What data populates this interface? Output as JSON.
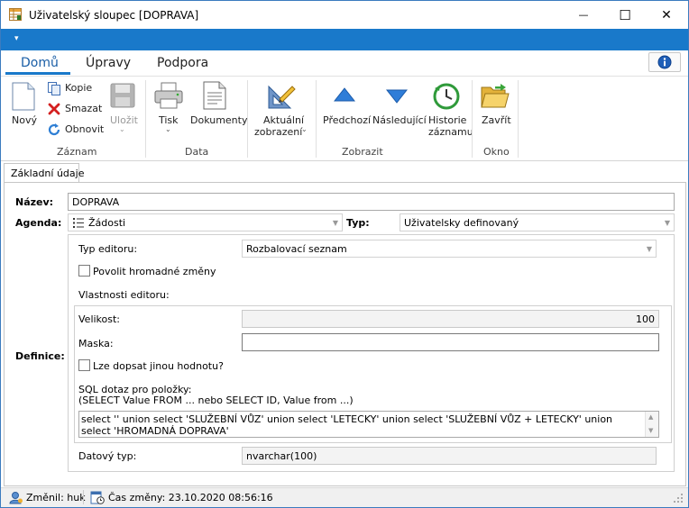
{
  "window": {
    "title": "Uživatelský sloupec [DOPRAVA]",
    "minimize_glyph": "—",
    "maximize_glyph": "☐",
    "close_glyph": "✕"
  },
  "qat": {
    "arrow_glyph": "▾"
  },
  "tabs": [
    {
      "label": "Domů"
    },
    {
      "label": "Úpravy"
    },
    {
      "label": "Podpora"
    }
  ],
  "info_icon": "info-icon",
  "ribbon": {
    "zaznam": {
      "label": "Záznam",
      "novy": "Nový",
      "kopie": "Kopie",
      "smazat": "Smazat",
      "obnovit": "Obnovit",
      "ulozit": "Uložit"
    },
    "data": {
      "label": "Data",
      "tisk": "Tisk",
      "dokumenty": "Dokumenty"
    },
    "aktualni": {
      "line1": "Aktuální",
      "line2": "zobrazení"
    },
    "zobrazit": {
      "label": "Zobrazit",
      "predchozi": "Předchozí",
      "nasledujici": "Následující",
      "historie1": "Historie",
      "historie2": "záznamu"
    },
    "okno": {
      "label": "Okno",
      "zavrit": "Zavřít"
    }
  },
  "page_tab": "Základní údaje",
  "form": {
    "nazev_label": "Název:",
    "nazev_value": "DOPRAVA",
    "agenda_label": "Agenda:",
    "agenda_value": "Žádosti",
    "typ_label": "Typ:",
    "typ_value": "Uživatelsky definovaný",
    "definice_label": "Definice:",
    "typ_editoru_label": "Typ editoru:",
    "typ_editoru_value": "Rozbalovací seznam",
    "povolit_label": "Povolit hromadné změny",
    "vlastnosti_label": "Vlastnosti editoru:",
    "velikost_label": "Velikost:",
    "velikost_value": "100",
    "maska_label": "Maska:",
    "maska_value": "",
    "lze_label": "Lze dopsat jinou hodnotu?",
    "sql_label1": "SQL dotaz pro položky:",
    "sql_label2": "(SELECT Value FROM ... nebo SELECT ID, Value from ...)",
    "sql_value": "select '' union select 'SLUŽEBNÍ VŮZ' union select 'LETECKY' union select 'SLUŽEBNÍ VŮZ + LETECKY' union select 'HROMADNÁ DOPRAVA'",
    "datovy_label": "Datový typ:",
    "datovy_value": "nvarchar(100)"
  },
  "status": {
    "zmenil": "Změnil: huk",
    "cas": "Čas změny: 23.10.2020 08:56:16"
  }
}
